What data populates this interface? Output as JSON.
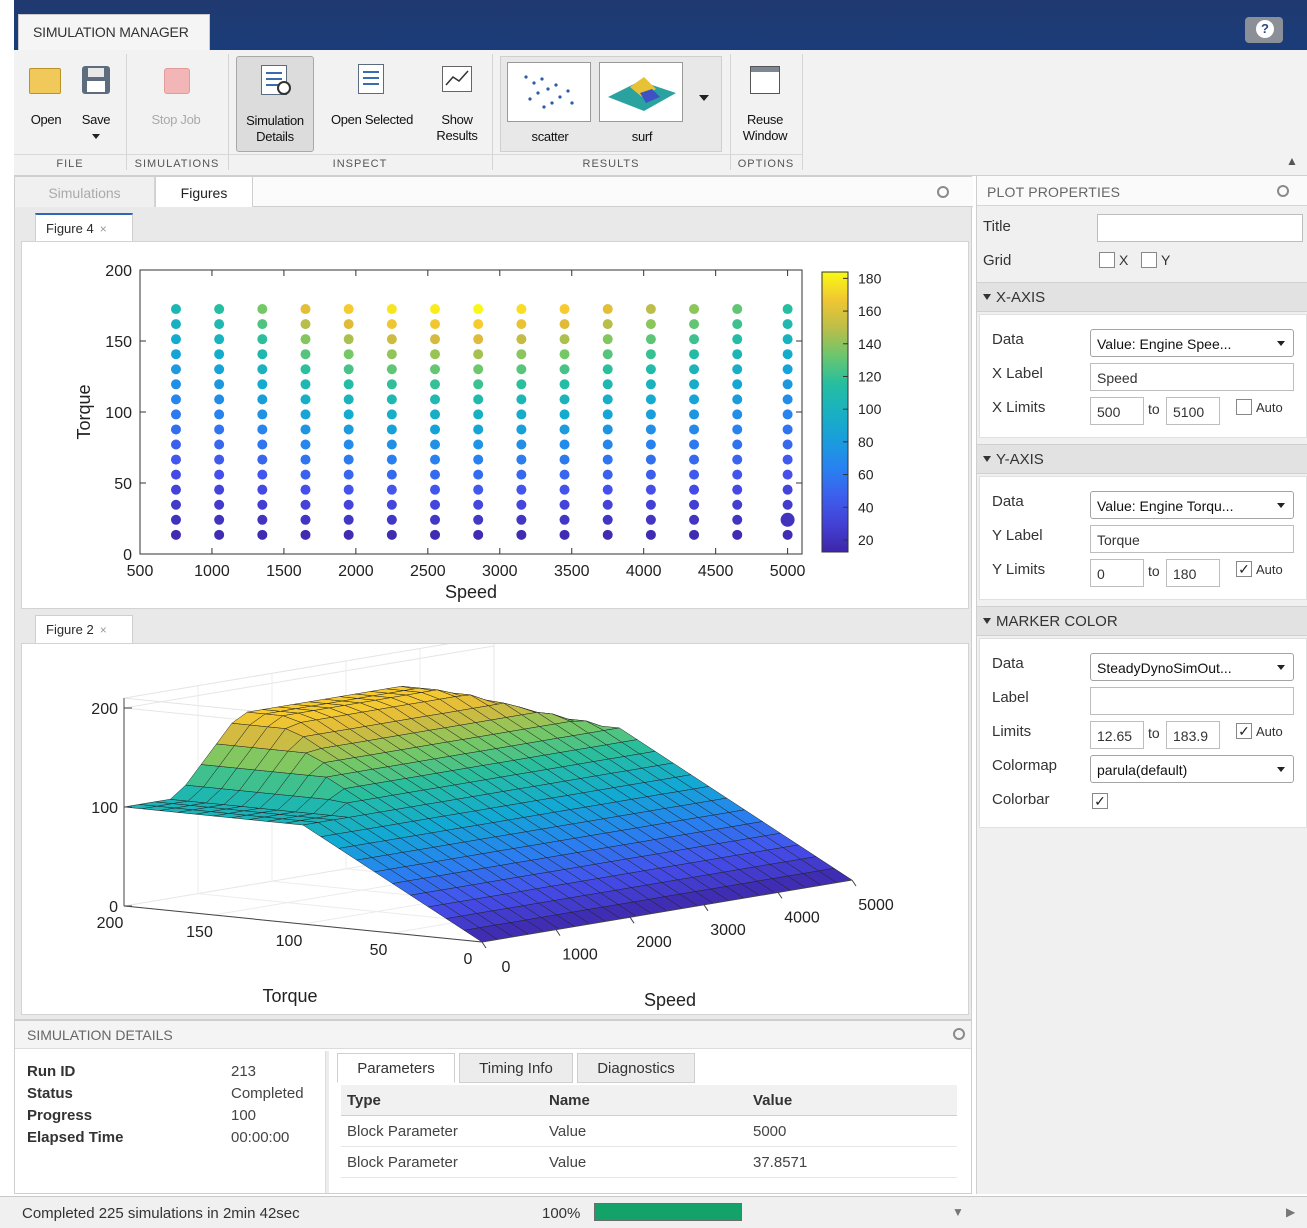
{
  "app": {
    "tab_title": "SIMULATION MANAGER",
    "help_label": "?"
  },
  "ribbon": {
    "buttons": {
      "open": "Open",
      "save": "Save",
      "stop_job": "Stop Job",
      "simulation_details_1": "Simulation",
      "simulation_details_2": "Details",
      "open_selected": "Open Selected",
      "show_results_1": "Show",
      "show_results_2": "Results",
      "scatter": "scatter",
      "surf": "surf",
      "reuse_window_1": "Reuse",
      "reuse_window_2": "Window"
    },
    "sections": {
      "file": "FILE",
      "simulations": "SIMULATIONS",
      "inspect": "INSPECT",
      "results": "RESULTS",
      "options": "OPTIONS"
    }
  },
  "doc_tabs": {
    "simulations": "Simulations",
    "figures": "Figures"
  },
  "figures": {
    "figure4_tab": "Figure 4",
    "figure2_tab": "Figure 2",
    "close_glyph": "×"
  },
  "chart_data": [
    {
      "type": "scatter",
      "title": "",
      "xlabel": "Speed",
      "ylabel": "Torque",
      "xlim": [
        500,
        5100
      ],
      "ylim": [
        0,
        200
      ],
      "x_ticks": [
        500,
        1000,
        1500,
        2000,
        2500,
        3000,
        3500,
        4000,
        4500,
        5000
      ],
      "y_ticks": [
        0,
        50,
        100,
        150,
        200
      ],
      "x": [
        750,
        1050,
        1350,
        1650,
        1950,
        2250,
        2550,
        2850,
        3150,
        3450,
        3750,
        4050,
        4350,
        4650,
        5000
      ],
      "y": [
        13.5,
        24.1,
        34.7,
        45.3,
        55.9,
        66.5,
        77.1,
        87.7,
        98.3,
        108.9,
        119.5,
        130.1,
        140.7,
        151.3,
        161.9,
        172.5
      ],
      "color_max": [
        105,
        115,
        135,
        160,
        170,
        178,
        180,
        183,
        176,
        170,
        160,
        150,
        140,
        130,
        115
      ],
      "colorbar": {
        "ticks": [
          20,
          40,
          60,
          80,
          100,
          120,
          140,
          160,
          180
        ],
        "limits": [
          12.65,
          183.9
        ],
        "colormap": "parula"
      },
      "grid": false
    },
    {
      "type": "surface",
      "title": "",
      "xlabel": "Speed",
      "ylabel": "Torque",
      "x_ticks": [
        0,
        1000,
        2000,
        3000,
        4000,
        5000
      ],
      "y_ticks": [
        0,
        50,
        100,
        150,
        200
      ],
      "z_ticks": [
        0,
        100,
        200
      ],
      "colormap": "parula"
    }
  ],
  "plot_properties": {
    "header": "PLOT PROPERTIES",
    "title_label": "Title",
    "title_value": "",
    "grid_label": "Grid",
    "grid_x": "X",
    "grid_y": "Y",
    "x_axis": {
      "section": "X-AXIS",
      "data_label": "Data",
      "data_value": "Value: Engine Spee...",
      "xlabel_label": "X Label",
      "xlabel_value": "Speed",
      "limits_label": "X Limits",
      "min": "500",
      "to": "to",
      "max": "5100",
      "auto": "Auto",
      "auto_checked": false
    },
    "y_axis": {
      "section": "Y-AXIS",
      "data_label": "Data",
      "data_value": "Value: Engine Torqu...",
      "ylabel_label": "Y Label",
      "ylabel_value": "Torque",
      "limits_label": "Y Limits",
      "min": "0",
      "to": "to",
      "max": "180",
      "auto": "Auto",
      "auto_checked": true
    },
    "marker_color": {
      "section": "MARKER COLOR",
      "data_label": "Data",
      "data_value": "SteadyDynoSimOut...",
      "label_label": "Label",
      "label_value": "",
      "limits_label": "Limits",
      "min": "12.65",
      "to": "to",
      "max": "183.9",
      "auto": "Auto",
      "auto_checked": true,
      "colormap_label": "Colormap",
      "colormap_value": "parula(default)",
      "colorbar_label": "Colorbar",
      "colorbar_checked": true
    },
    "check_glyph": "✓"
  },
  "simulation_details": {
    "header": "SIMULATION DETAILS",
    "run_id_label": "Run ID",
    "run_id": "213",
    "status_label": "Status",
    "status": "Completed",
    "progress_label": "Progress",
    "progress": "100",
    "elapsed_label": "Elapsed Time",
    "elapsed": "00:00:00",
    "tabs": [
      "Parameters",
      "Timing Info",
      "Diagnostics"
    ],
    "columns": [
      "Type",
      "Name",
      "Value"
    ],
    "rows": [
      [
        "Block Parameter",
        "Value",
        "5000"
      ],
      [
        "Block Parameter",
        "Value",
        "37.8571"
      ]
    ]
  },
  "status_bar": {
    "message": "Completed 225 simulations in 2min 42sec",
    "progress_text": "100%",
    "progress_fraction": 1.0
  },
  "colors": {
    "accent_blue": "#2e66b8",
    "progress_green": "#13a36a",
    "toolstrip_blue": "#1b3c7a"
  }
}
